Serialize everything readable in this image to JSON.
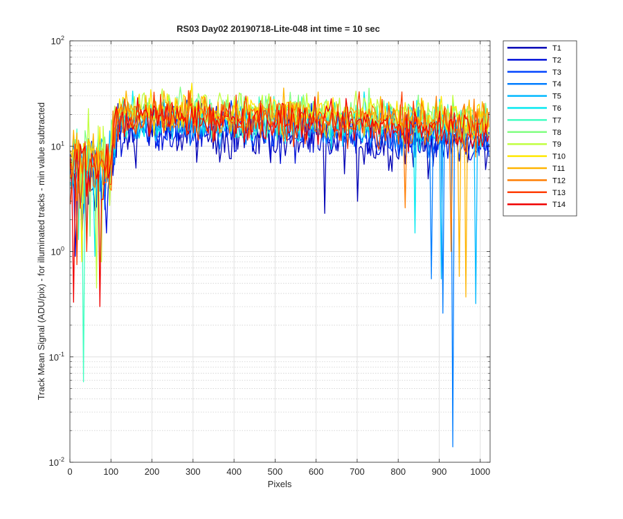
{
  "chart_data": {
    "type": "line",
    "title": "RS03 Day02 20190718-Lite-048 int time = 10 sec",
    "xlabel": "Pixels",
    "ylabel": "Track Mean Signal (ADU/pix) - for illuminated tracks - min value subtracted",
    "xlim": [
      0,
      1024
    ],
    "ylim": [
      0.01,
      100
    ],
    "yscale": "log",
    "grid": true,
    "minor_grid": true,
    "legend_position": "outside-right",
    "xticks": [
      0,
      100,
      200,
      300,
      400,
      500,
      600,
      700,
      800,
      900,
      1000
    ],
    "xtick_labels": [
      "0",
      "100",
      "200",
      "300",
      "400",
      "500",
      "600",
      "700",
      "800",
      "900",
      "1000"
    ],
    "yticks": [
      0.01,
      0.1,
      1,
      10,
      100
    ],
    "ytick_labels": [
      {
        "base": "10",
        "exp": "-2"
      },
      {
        "base": "10",
        "exp": "-1"
      },
      {
        "base": "10",
        "exp": "0"
      },
      {
        "base": "10",
        "exp": "1"
      },
      {
        "base": "10",
        "exp": "2"
      }
    ],
    "x_step": 4,
    "series": [
      {
        "name": "T1",
        "color": "#0000b4",
        "base": 13,
        "slope": 0.75,
        "noise": 0.42,
        "dips": [
          [
            30,
            1.2
          ],
          [
            620,
            2.3
          ],
          [
            700,
            3.0
          ]
        ]
      },
      {
        "name": "T2",
        "color": "#0010d8",
        "base": 14,
        "slope": 0.78,
        "noise": 0.38,
        "dips": [
          [
            12,
            0.9
          ],
          [
            90,
            1.5
          ]
        ]
      },
      {
        "name": "T3",
        "color": "#0044ff",
        "base": 15,
        "slope": 0.8,
        "noise": 0.35,
        "dips": [
          [
            40,
            1.1
          ]
        ]
      },
      {
        "name": "T4",
        "color": "#007cff",
        "base": 16,
        "slope": 0.82,
        "noise": 0.33,
        "dips": [
          [
            880,
            0.55
          ],
          [
            932,
            0.014
          ],
          [
            910,
            0.26
          ]
        ]
      },
      {
        "name": "T5",
        "color": "#00b8ff",
        "base": 17,
        "slope": 0.84,
        "noise": 0.33,
        "dips": [
          [
            905,
            0.55
          ],
          [
            990,
            0.32
          ]
        ]
      },
      {
        "name": "T6",
        "color": "#00e8f0",
        "base": 18,
        "slope": 0.86,
        "noise": 0.33,
        "dips": [
          [
            60,
            0.9
          ],
          [
            840,
            1.5
          ]
        ]
      },
      {
        "name": "T7",
        "color": "#40ffc0",
        "base": 19,
        "slope": 0.87,
        "noise": 0.32,
        "dips": [
          [
            34,
            0.058
          ],
          [
            20,
            1.3
          ]
        ]
      },
      {
        "name": "T8",
        "color": "#80ff80",
        "base": 21,
        "slope": 0.88,
        "noise": 0.3,
        "dips": [
          [
            50,
            1.4
          ]
        ]
      },
      {
        "name": "T9",
        "color": "#c0ff40",
        "base": 22,
        "slope": 0.9,
        "noise": 0.3,
        "dips": [
          [
            64,
            0.45
          ],
          [
            75,
            0.8
          ]
        ]
      },
      {
        "name": "T10",
        "color": "#ffe800",
        "base": 21,
        "slope": 0.88,
        "noise": 0.32,
        "dips": [
          [
            30,
            0.8
          ]
        ]
      },
      {
        "name": "T11",
        "color": "#ffb400",
        "base": 20,
        "slope": 0.86,
        "noise": 0.33,
        "dips": [
          [
            950,
            0.58
          ],
          [
            965,
            0.37
          ]
        ]
      },
      {
        "name": "T12",
        "color": "#ff7c00",
        "base": 19,
        "slope": 0.84,
        "noise": 0.34,
        "dips": [
          [
            818,
            2.6
          ],
          [
            930,
            1.0
          ]
        ]
      },
      {
        "name": "T13",
        "color": "#ff3c00",
        "base": 18,
        "slope": 0.82,
        "noise": 0.35,
        "dips": [
          [
            18,
            0.75
          ],
          [
            40,
            1.0
          ]
        ]
      },
      {
        "name": "T14",
        "color": "#f00000",
        "base": 18,
        "slope": 0.8,
        "noise": 0.3,
        "dips": [
          [
            8,
            0.33
          ],
          [
            72,
            0.3
          ]
        ]
      }
    ]
  }
}
